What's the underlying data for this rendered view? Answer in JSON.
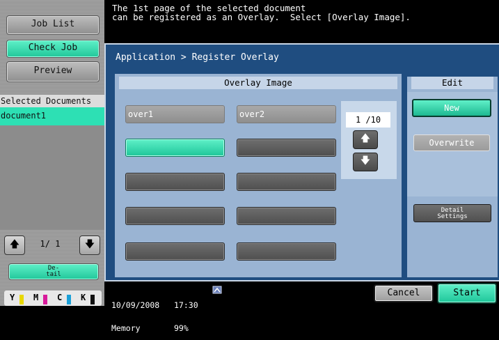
{
  "left_panel": {
    "job_list_label": "Job List",
    "check_job_label": "Check Job",
    "preview_label": "Preview",
    "selected_documents_title": "Selected Documents",
    "selected_document": "document1",
    "pager": "1/  1",
    "detail_label_line1": "De-",
    "detail_label_line2": "tail",
    "toner": [
      {
        "letter": "Y",
        "color": "#e8d800"
      },
      {
        "letter": "M",
        "color": "#d81b9b"
      },
      {
        "letter": "C",
        "color": "#1aa0d8"
      },
      {
        "letter": "K",
        "color": "#111111"
      }
    ]
  },
  "message": "The 1st page of the selected document\ncan be registered as an Overlay.  Select [Overlay Image].",
  "breadcrumb": "Application > Register Overlay",
  "overlay": {
    "header": "Overlay Image",
    "slots": [
      {
        "label": "over1",
        "state": "registered"
      },
      {
        "label": "over2",
        "state": "registered"
      },
      {
        "label": "",
        "state": "selected"
      },
      {
        "label": "",
        "state": "empty"
      },
      {
        "label": "",
        "state": "empty"
      },
      {
        "label": "",
        "state": "empty"
      },
      {
        "label": "",
        "state": "empty"
      },
      {
        "label": "",
        "state": "empty"
      },
      {
        "label": "",
        "state": "empty"
      },
      {
        "label": "",
        "state": "empty"
      }
    ],
    "page_indicator": "1  /10"
  },
  "edit": {
    "header": "Edit",
    "new_label": "New",
    "overwrite_label": "Overwrite",
    "detail_settings_line1": "Detail",
    "detail_settings_line2": "Settings"
  },
  "status": {
    "datetime": "10/09/2008   17:30",
    "memory": "Memory       99%",
    "cancel_label": "Cancel",
    "start_label": "Start"
  },
  "colors": {
    "accent_green": "#2de0b4",
    "panel_blue": "#1f4d80"
  }
}
